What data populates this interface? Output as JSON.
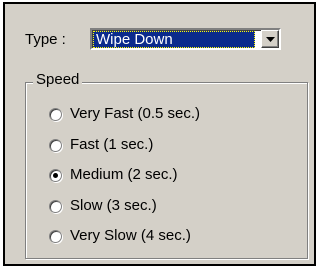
{
  "type_field": {
    "label": "Type :",
    "value": "Wipe Down"
  },
  "speed_group": {
    "legend": "Speed",
    "options": [
      {
        "label": "Very Fast (0.5 sec.)",
        "checked": false
      },
      {
        "label": "Fast (1 sec.)",
        "checked": false
      },
      {
        "label": "Medium (2 sec.)",
        "checked": true
      },
      {
        "label": "Slow (3 sec.)",
        "checked": false
      },
      {
        "label": "Very Slow (4 sec.)",
        "checked": false
      }
    ]
  },
  "colors": {
    "selection": "#0a2a8c",
    "face": "#d4d0c8"
  }
}
